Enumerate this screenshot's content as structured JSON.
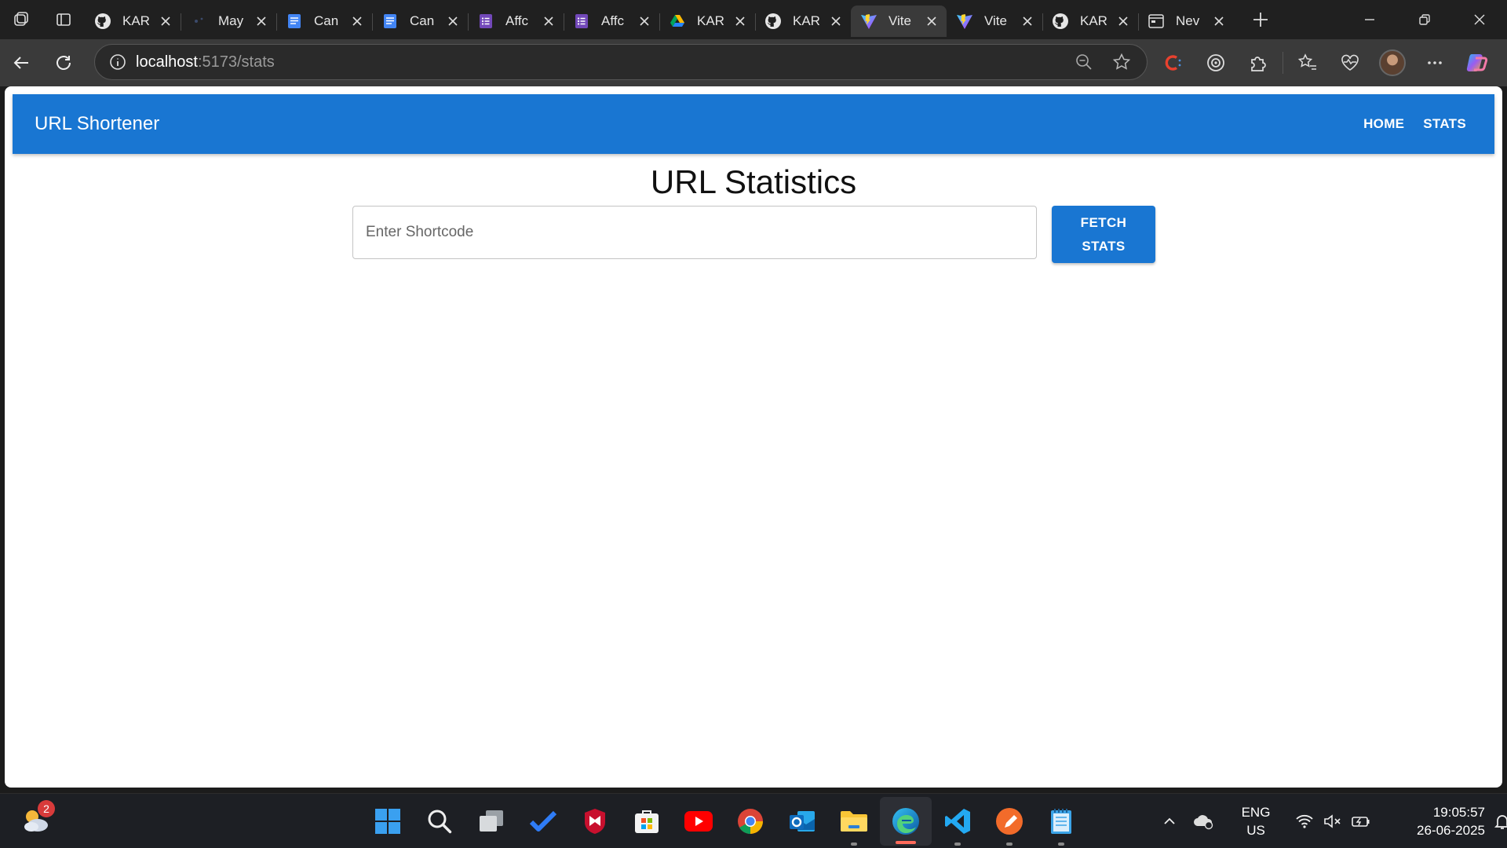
{
  "browser": {
    "tabs": [
      {
        "title": "KAR",
        "icon": "github-icon"
      },
      {
        "title": "May",
        "icon": "generic-site-icon"
      },
      {
        "title": "Can",
        "icon": "docs-icon"
      },
      {
        "title": "Can",
        "icon": "docs-icon"
      },
      {
        "title": "Affc",
        "icon": "forms-icon"
      },
      {
        "title": "Affc",
        "icon": "forms-icon"
      },
      {
        "title": "KAR",
        "icon": "drive-icon"
      },
      {
        "title": "KAR",
        "icon": "github-icon"
      },
      {
        "title": "Vite",
        "icon": "vite-icon",
        "active": true
      },
      {
        "title": "Vite",
        "icon": "vite-icon"
      },
      {
        "title": "KAR",
        "icon": "github-icon"
      },
      {
        "title": "Nev",
        "icon": "newtab-icon"
      }
    ],
    "address": {
      "host": "localhost",
      "path": ":5173/stats"
    }
  },
  "app": {
    "title": "URL Shortener",
    "nav": {
      "home": "HOME",
      "stats": "STATS"
    },
    "page_title": "URL Statistics",
    "shortcode_input": {
      "placeholder": "Enter Shortcode",
      "value": ""
    },
    "fetch_button": "FETCH\nSTATS",
    "accent_color": "#1976d2"
  },
  "taskbar": {
    "weather_badge": "2",
    "apps": [
      "windows-start-icon",
      "search-icon",
      "task-view-icon",
      "todo-icon",
      "mcafee-icon",
      "store-icon",
      "youtube-icon",
      "chrome-icon",
      "outlook-icon",
      "file-explorer-icon",
      "edge-icon",
      "vscode-icon",
      "pen-app-icon",
      "notepad-icon"
    ],
    "language": "ENG",
    "region": "US",
    "time": "19:05:57",
    "date": "26-06-2025"
  }
}
